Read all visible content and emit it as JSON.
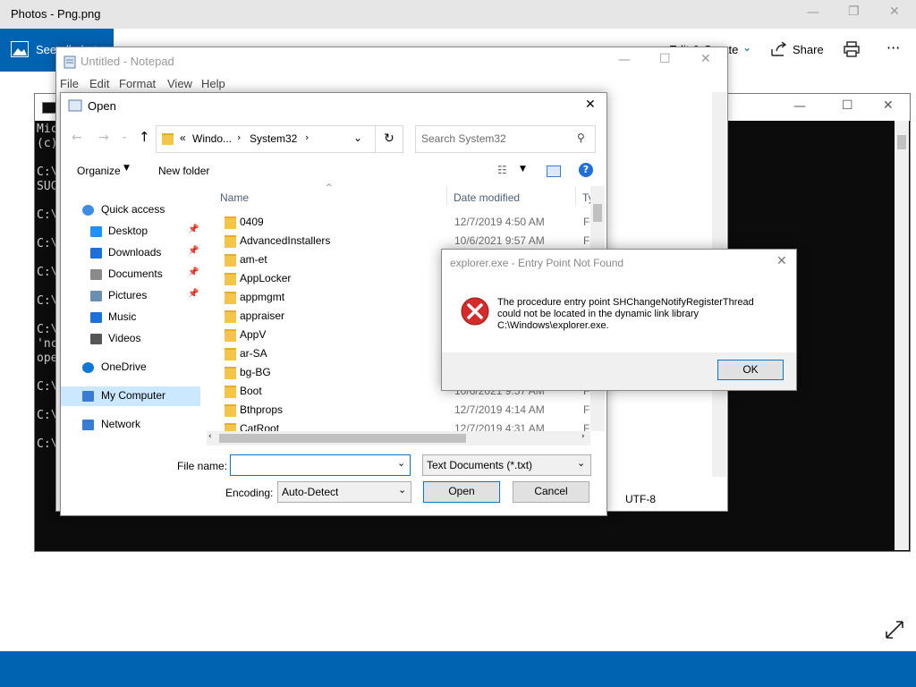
{
  "photos": {
    "title": "Photos - Png.png",
    "see_all": "See all photos",
    "edit_create": "Edit & Create",
    "share": "Share"
  },
  "cmd": {
    "lines": [
      "Mic",
      "(c)",
      "C:\\",
      "SUC",
      "C:\\",
      "C:\\",
      "C:\\",
      "C:\\",
      "C:\\",
      "'nc",
      "ope",
      "C:\\",
      "C:\\",
      "C:\\"
    ]
  },
  "notepad": {
    "title": "Untitled - Notepad",
    "menu": [
      "File",
      "Edit",
      "Format",
      "View",
      "Help"
    ],
    "encoding_status": "UTF-8"
  },
  "open_dialog": {
    "title": "Open",
    "breadcrumb": [
      "Windo...",
      "System32"
    ],
    "breadcrumb_prefix": "«",
    "search_placeholder": "Search System32",
    "organize": "Organize",
    "new_folder": "New folder",
    "nav": [
      {
        "label": "Quick access",
        "icon": "star-icon",
        "color": "#3d8ee0"
      },
      {
        "label": "Desktop",
        "icon": "desktop-icon",
        "color": "#1e90ff"
      },
      {
        "label": "Downloads",
        "icon": "download-icon",
        "color": "#1e6fd9"
      },
      {
        "label": "Documents",
        "icon": "document-icon",
        "color": "#8a8a8a"
      },
      {
        "label": "Pictures",
        "icon": "pictures-icon",
        "color": "#6a8fb0"
      },
      {
        "label": "Music",
        "icon": "music-icon",
        "color": "#1e6fd9"
      },
      {
        "label": "Videos",
        "icon": "videos-icon",
        "color": "#555"
      },
      {
        "label": "OneDrive",
        "icon": "cloud-icon",
        "color": "#0f78d4"
      },
      {
        "label": "My Computer",
        "icon": "computer-icon",
        "color": "#3a7bd5"
      },
      {
        "label": "Network",
        "icon": "network-icon",
        "color": "#3a7bd5"
      }
    ],
    "columns": [
      "Name",
      "Date modified",
      "Ty"
    ],
    "files": [
      {
        "name": "0409",
        "date": "12/7/2019 4:50 AM",
        "type": "Fi"
      },
      {
        "name": "AdvancedInstallers",
        "date": "10/6/2021 9:57 AM",
        "type": "Fi"
      },
      {
        "name": "am-et",
        "date": "",
        "type": ""
      },
      {
        "name": "AppLocker",
        "date": "",
        "type": ""
      },
      {
        "name": "appmgmt",
        "date": "",
        "type": ""
      },
      {
        "name": "appraiser",
        "date": "",
        "type": ""
      },
      {
        "name": "AppV",
        "date": "",
        "type": ""
      },
      {
        "name": "ar-SA",
        "date": "",
        "type": ""
      },
      {
        "name": "bg-BG",
        "date": "",
        "type": ""
      },
      {
        "name": "Boot",
        "date": "10/6/2021 9:57 AM",
        "type": "Fi"
      },
      {
        "name": "Bthprops",
        "date": "12/7/2019 4:14 AM",
        "type": "Fi"
      },
      {
        "name": "CatRoot",
        "date": "12/7/2019 4:31 AM",
        "type": "Fi"
      }
    ],
    "file_name_label": "File name:",
    "file_name_value": "",
    "file_type": "Text Documents (*.txt)",
    "encoding_label": "Encoding:",
    "encoding_value": "Auto-Detect",
    "open_button": "Open",
    "cancel_button": "Cancel"
  },
  "error_dialog": {
    "title": "explorer.exe - Entry Point Not Found",
    "message_line1": "The procedure entry point SHChangeNotifyRegisterThread",
    "message_line2": "could not be located in the dynamic link library",
    "message_line3": "C:\\Windows\\explorer.exe.",
    "ok_button": "OK"
  }
}
